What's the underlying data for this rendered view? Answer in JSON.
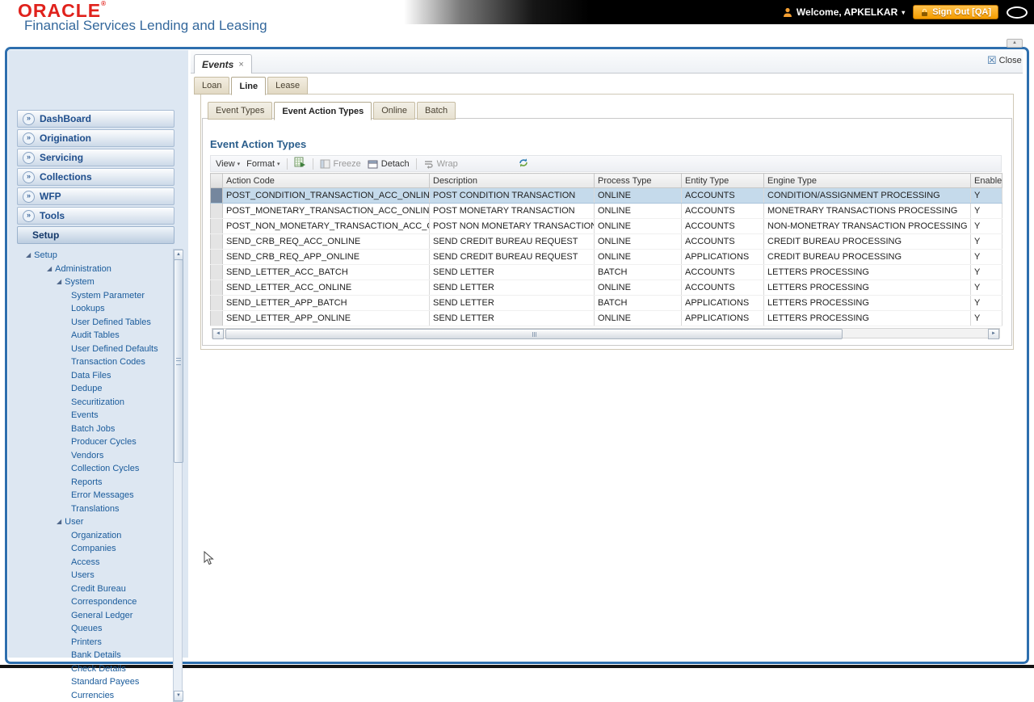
{
  "header": {
    "logo": "ORACLE",
    "logo_mark": "®",
    "product": "Financial Services Lending and Leasing",
    "welcome_label": "Welcome, APKELKAR",
    "sign_out_label": "Sign Out [QA]"
  },
  "icons": {
    "accordion_arrow": "»",
    "tree_expander": "◢",
    "caret_down": "▾",
    "tab_close": "×",
    "close_box": "☒",
    "up_arrow": "▲",
    "down_arrow": "▼",
    "left_arrow": "◄",
    "right_arrow": "►"
  },
  "sidebar": {
    "accordion": [
      {
        "label": "DashBoard"
      },
      {
        "label": "Origination"
      },
      {
        "label": "Servicing"
      },
      {
        "label": "Collections"
      },
      {
        "label": "WFP"
      },
      {
        "label": "Tools"
      }
    ],
    "setup_label": "Setup",
    "tree": [
      {
        "label": "Setup",
        "level": 0,
        "expandable": true
      },
      {
        "label": "Administration",
        "level": 1,
        "expandable": true
      },
      {
        "label": "System",
        "level": 2,
        "expandable": true
      },
      {
        "label": "System Parameter",
        "level": 3
      },
      {
        "label": "Lookups",
        "level": 3
      },
      {
        "label": "User Defined Tables",
        "level": 3
      },
      {
        "label": "Audit Tables",
        "level": 3
      },
      {
        "label": "User Defined Defaults",
        "level": 3
      },
      {
        "label": "Transaction Codes",
        "level": 3
      },
      {
        "label": "Data Files",
        "level": 3
      },
      {
        "label": "Dedupe",
        "level": 3
      },
      {
        "label": "Securitization",
        "level": 3
      },
      {
        "label": "Events",
        "level": 3
      },
      {
        "label": "Batch Jobs",
        "level": 3
      },
      {
        "label": "Producer Cycles",
        "level": 3
      },
      {
        "label": "Vendors",
        "level": 3
      },
      {
        "label": "Collection Cycles",
        "level": 3
      },
      {
        "label": "Reports",
        "level": 3
      },
      {
        "label": "Error Messages",
        "level": 3
      },
      {
        "label": "Translations",
        "level": 3
      },
      {
        "label": "User",
        "level": 2,
        "expandable": true
      },
      {
        "label": "Organization",
        "level": 3
      },
      {
        "label": "Companies",
        "level": 3
      },
      {
        "label": "Access",
        "level": 3
      },
      {
        "label": "Users",
        "level": 3
      },
      {
        "label": "Credit Bureau",
        "level": 3
      },
      {
        "label": "Correspondence",
        "level": 3
      },
      {
        "label": "General Ledger",
        "level": 3
      },
      {
        "label": "Queues",
        "level": 3
      },
      {
        "label": "Printers",
        "level": 3
      },
      {
        "label": "Bank Details",
        "level": 3
      },
      {
        "label": "Check Details",
        "level": 3
      },
      {
        "label": "Standard Payees",
        "level": 3
      },
      {
        "label": "Currencies",
        "level": 3
      }
    ]
  },
  "main": {
    "doc_tab_label": "Events",
    "close_label": "Close",
    "tabs": [
      {
        "label": "Loan"
      },
      {
        "label": "Line",
        "state": "active"
      },
      {
        "label": "Lease"
      }
    ],
    "subtabs": [
      {
        "label": "Event Types"
      },
      {
        "label": "Event Action Types",
        "state": "active"
      },
      {
        "label": "Online"
      },
      {
        "label": "Batch"
      }
    ],
    "panel_title": "Event Action Types",
    "toolbar": {
      "view_label": "View",
      "format_label": "Format",
      "freeze_label": "Freeze",
      "detach_label": "Detach",
      "wrap_label": "Wrap"
    },
    "table": {
      "columns": [
        "Action Code",
        "Description",
        "Process Type",
        "Entity Type",
        "Engine Type",
        "Enabled"
      ],
      "rows": [
        {
          "state": "selected",
          "action_code": "POST_CONDITION_TRANSACTION_ACC_ONLINE",
          "description": "POST CONDITION TRANSACTION",
          "process_type": "ONLINE",
          "entity_type": "ACCOUNTS",
          "engine_type": "CONDITION/ASSIGNMENT PROCESSING",
          "enabled": "Y"
        },
        {
          "action_code": "POST_MONETARY_TRANSACTION_ACC_ONLINE",
          "description": "POST MONETARY TRANSACTION",
          "process_type": "ONLINE",
          "entity_type": "ACCOUNTS",
          "engine_type": "MONETRARY TRANSACTIONS PROCESSING",
          "enabled": "Y"
        },
        {
          "action_code": "POST_NON_MONETARY_TRANSACTION_ACC_ON...",
          "description": "POST NON MONETARY TRANSACTION",
          "process_type": "ONLINE",
          "entity_type": "ACCOUNTS",
          "engine_type": "NON-MONETRAY TRANSACTION PROCESSING",
          "enabled": "Y"
        },
        {
          "action_code": "SEND_CRB_REQ_ACC_ONLINE",
          "description": "SEND CREDIT BUREAU REQUEST",
          "process_type": "ONLINE",
          "entity_type": "ACCOUNTS",
          "engine_type": "CREDIT BUREAU PROCESSING",
          "enabled": "Y"
        },
        {
          "action_code": "SEND_CRB_REQ_APP_ONLINE",
          "description": "SEND CREDIT BUREAU REQUEST",
          "process_type": "ONLINE",
          "entity_type": "APPLICATIONS",
          "engine_type": "CREDIT BUREAU PROCESSING",
          "enabled": "Y"
        },
        {
          "action_code": "SEND_LETTER_ACC_BATCH",
          "description": "SEND LETTER",
          "process_type": "BATCH",
          "entity_type": "ACCOUNTS",
          "engine_type": "LETTERS PROCESSING",
          "enabled": "Y"
        },
        {
          "action_code": "SEND_LETTER_ACC_ONLINE",
          "description": "SEND LETTER",
          "process_type": "ONLINE",
          "entity_type": "ACCOUNTS",
          "engine_type": "LETTERS PROCESSING",
          "enabled": "Y"
        },
        {
          "action_code": "SEND_LETTER_APP_BATCH",
          "description": "SEND LETTER",
          "process_type": "BATCH",
          "entity_type": "APPLICATIONS",
          "engine_type": "LETTERS PROCESSING",
          "enabled": "Y"
        },
        {
          "action_code": "SEND_LETTER_APP_ONLINE",
          "description": "SEND LETTER",
          "process_type": "ONLINE",
          "entity_type": "APPLICATIONS",
          "engine_type": "LETTERS PROCESSING",
          "enabled": "Y"
        }
      ]
    }
  },
  "colors": {
    "oracle_red": "#e0221c",
    "brand_blue": "#34689c",
    "frame_blue": "#2e6fae",
    "selected_row": "#c5daeb",
    "signout_orange": "#f59d00"
  }
}
